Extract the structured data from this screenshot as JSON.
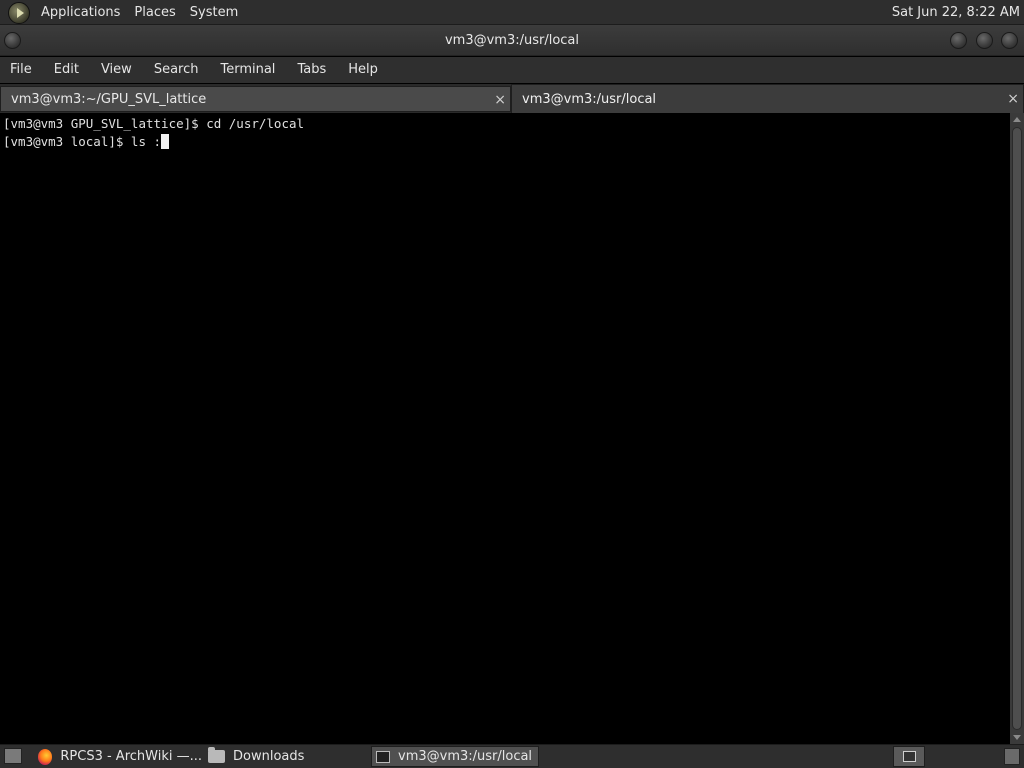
{
  "top_panel": {
    "menus": [
      "Applications",
      "Places",
      "System"
    ],
    "clock": "Sat Jun 22,  8:22 AM"
  },
  "window": {
    "title": "vm3@vm3:/usr/local"
  },
  "menubar": [
    "File",
    "Edit",
    "View",
    "Search",
    "Terminal",
    "Tabs",
    "Help"
  ],
  "tabs": [
    {
      "label": "vm3@vm3:~/GPU_SVL_lattice",
      "close": "×",
      "active": false
    },
    {
      "label": "vm3@vm3:/usr/local",
      "close": "×",
      "active": true
    }
  ],
  "terminal": {
    "lines": [
      "[vm3@vm3 GPU_SVL_lattice]$ cd /usr/local",
      "[vm3@vm3 local]$ ls :"
    ]
  },
  "taskbar": {
    "tasks": [
      {
        "label": "RPCS3 - ArchWiki —...",
        "icon": "firefox-icon"
      },
      {
        "label": "Downloads",
        "icon": "folder-icon"
      },
      {
        "label": "vm3@vm3:/usr/local",
        "icon": "terminal-icon"
      }
    ]
  }
}
